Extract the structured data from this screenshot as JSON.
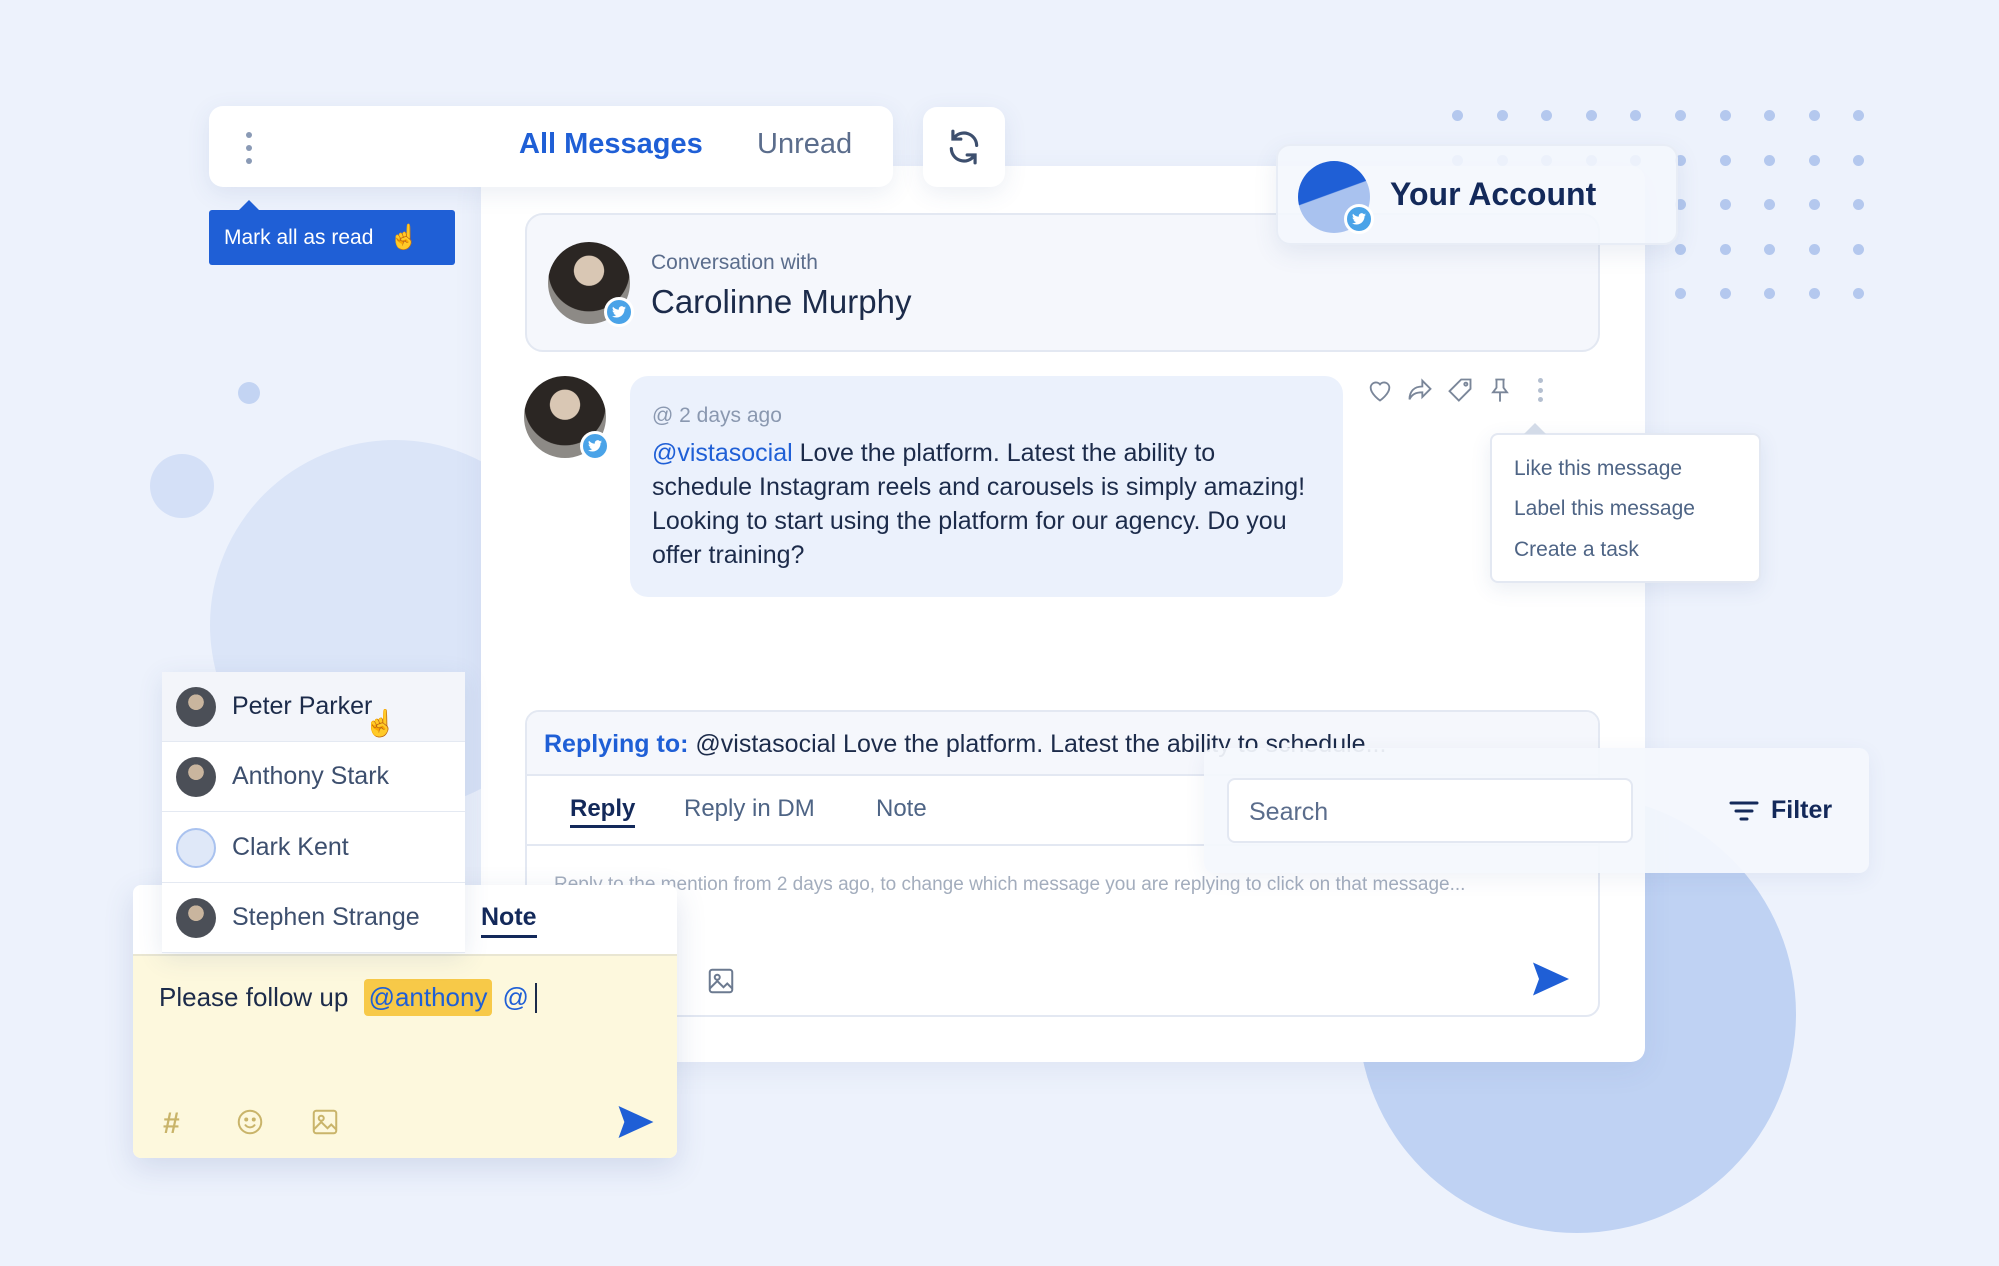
{
  "toolbar": {
    "tabs": [
      {
        "label": "All Messages",
        "active": true
      },
      {
        "label": "Unread",
        "active": false
      }
    ],
    "more_icon": "vertical-dots-icon",
    "refresh_icon": "refresh-icon"
  },
  "tooltip": {
    "label": "Mark all as read"
  },
  "conversation": {
    "prefix": "Conversation with",
    "name": "Carolinne Murphy",
    "network": "twitter"
  },
  "message": {
    "time": "@ 2 days ago",
    "mention": "@vistasocial",
    "text": " Love the platform. Latest the ability to schedule Instagram reels and carousels is simply amazing! Looking to start using the platform for our agency. Do you offer training?"
  },
  "message_actions": [
    "heart-icon",
    "share-icon",
    "tag-icon",
    "pin-icon",
    "more-icon"
  ],
  "action_menu": {
    "items": [
      "Like this message",
      "Label this message",
      "Create a task"
    ]
  },
  "account": {
    "label": "Your Account"
  },
  "reply": {
    "replying_label": "Replying to:",
    "replying_text": "@vistasocial Love the platform. Latest the ability to schedule...",
    "tabs": [
      "Reply",
      "Reply in DM",
      "Note"
    ],
    "active_tab": "Reply",
    "placeholder": "Reply to the mention from 2 days ago, to change which message you are replying to click on that message..."
  },
  "search": {
    "placeholder": "Search",
    "filter_label": "Filter"
  },
  "mentions": {
    "users": [
      "Peter Parker",
      "Anthony Stark",
      "Clark Kent",
      "Stephen Strange"
    ]
  },
  "note": {
    "tab": "Note",
    "text": "Please follow up ",
    "mention": "@anthony",
    "trailing": "@"
  },
  "colors": {
    "accent": "#1f5fd6",
    "background": "#edf2fc",
    "note_bg": "#fdf8dd",
    "highlight": "#f7c948"
  }
}
